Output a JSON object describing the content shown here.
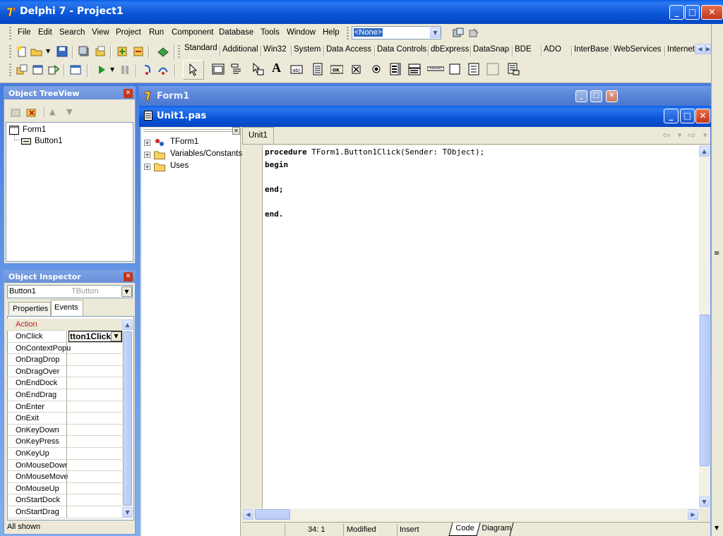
{
  "window": {
    "title": "Delphi 7 - Project1"
  },
  "menu": [
    "File",
    "Edit",
    "Search",
    "View",
    "Project",
    "Run",
    "Component",
    "Database",
    "Tools",
    "Window",
    "Help"
  ],
  "desktop_combo": {
    "value": "<None>"
  },
  "palette": {
    "tabs": [
      "Standard",
      "Additional",
      "Win32",
      "System",
      "Data Access",
      "Data Controls",
      "dbExpress",
      "DataSnap",
      "BDE",
      "ADO",
      "InterBase",
      "WebServices",
      "InternetE"
    ],
    "active": "Standard"
  },
  "tree_view": {
    "title": "Object TreeView",
    "nodes": [
      {
        "label": "Form1"
      },
      {
        "label": "Button1"
      }
    ]
  },
  "inspector": {
    "title": "Object Inspector",
    "object_name": "Button1",
    "object_type": "TButton",
    "tabs": [
      "Properties",
      "Events"
    ],
    "category": "Action",
    "events": [
      "OnClick",
      "OnContextPopu",
      "OnDragDrop",
      "OnDragOver",
      "OnEndDock",
      "OnEndDrag",
      "OnEnter",
      "OnExit",
      "OnKeyDown",
      "OnKeyPress",
      "OnKeyUp",
      "OnMouseDowr",
      "OnMouseMove",
      "OnMouseUp",
      "OnStartDock",
      "OnStartDrag"
    ],
    "onclick_value": "tton1Click",
    "status": "All shown"
  },
  "form_window": {
    "title": "Form1"
  },
  "unit_window": {
    "title": "Unit1.pas",
    "tab": "Unit1",
    "explorer": [
      "TForm1",
      "Variables/Constants",
      "Uses"
    ],
    "code": [
      {
        "kw": "procedure",
        "rest": " TForm1.Button1Click(Sender: TObject);"
      },
      {
        "kw": "begin",
        "rest": ""
      },
      {
        "kw": "",
        "rest": ""
      },
      {
        "kw": "end;",
        "rest": ""
      },
      {
        "kw": "",
        "rest": ""
      },
      {
        "kw": "end.",
        "rest": ""
      }
    ],
    "status": {
      "position": "34:  1",
      "modified": "Modified",
      "mode": "Insert"
    },
    "bottom_tabs": [
      "Code",
      "Diagram"
    ]
  },
  "colors": {
    "xp_blue": "#0b54d6",
    "face": "#ece9d8",
    "close_red": "#c2371b"
  }
}
